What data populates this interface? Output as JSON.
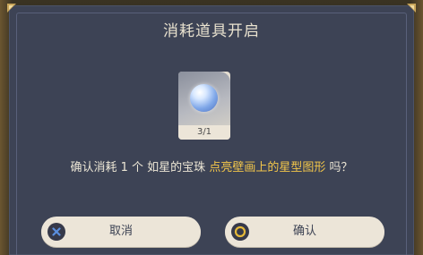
{
  "dialog": {
    "title": "消耗道具开启",
    "item": {
      "count": "3/1",
      "icon": "orb-icon"
    },
    "message": {
      "prefix": "确认消耗 1 个 如星的宝珠 ",
      "highlight": "点亮壁画上的星型图形",
      "suffix": " 吗？"
    },
    "buttons": {
      "cancel_label": "取消",
      "confirm_label": "确认"
    }
  },
  "colors": {
    "panel": "#3d4355",
    "title_text": "#e9e2cf",
    "highlight_text": "#f2c64a",
    "button_bg": "#ece5d8",
    "cancel_icon": "#5b8fe0",
    "confirm_icon": "#e5b93a"
  }
}
